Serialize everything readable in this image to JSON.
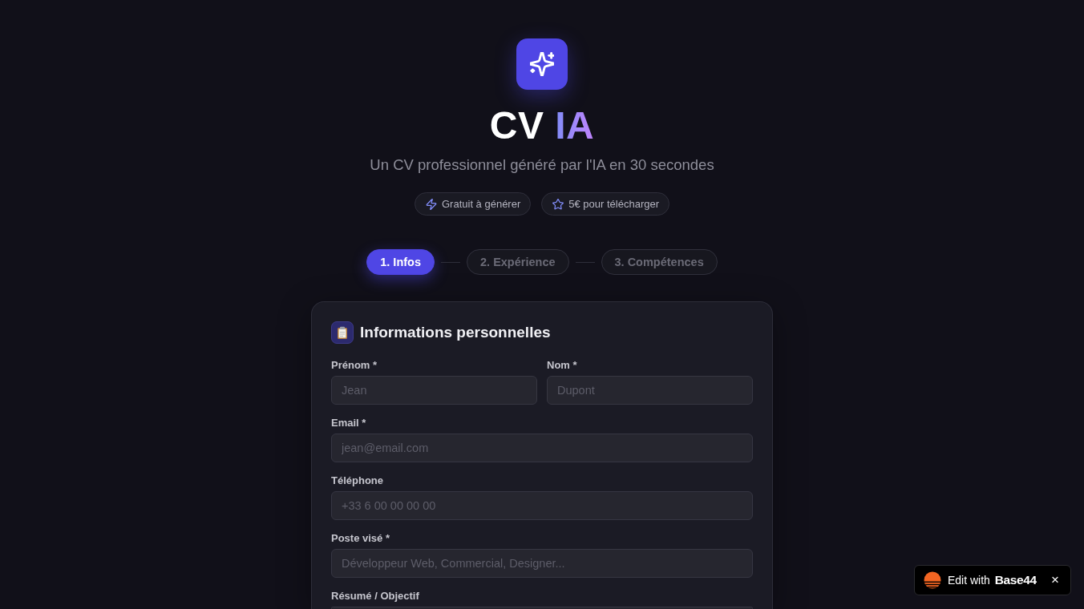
{
  "header": {
    "title": "CV",
    "title_accent": "IA",
    "subtitle": "Un CV professionnel généré par l'IA en 30 secondes",
    "badges": [
      {
        "kind": "bolt",
        "label": "Gratuit à générer"
      },
      {
        "kind": "star",
        "label": "5€ pour télécharger"
      }
    ]
  },
  "steps": [
    {
      "label": "1. Infos",
      "selected": true
    },
    {
      "label": "2. Expérience",
      "selected": false
    },
    {
      "label": "3. Compétences",
      "selected": false
    }
  ],
  "form": {
    "title": "Informations personnelles",
    "rows": [
      [
        {
          "kind": "text",
          "label": "Prénom *",
          "placeholder": "Jean"
        },
        {
          "kind": "text",
          "label": "Nom *",
          "placeholder": "Dupont"
        }
      ],
      [
        {
          "kind": "text",
          "label": "Email *",
          "placeholder": "jean@email.com"
        }
      ],
      [
        {
          "kind": "text",
          "label": "Téléphone",
          "placeholder": "+33 6 00 00 00 00"
        }
      ],
      [
        {
          "kind": "text",
          "label": "Poste visé *",
          "placeholder": "Développeur Web, Commercial, Designer..."
        }
      ],
      [
        {
          "kind": "textarea",
          "label": "Résumé / Objectif"
        }
      ]
    ]
  },
  "edit_banner": {
    "text": "Edit with **Base44**",
    "close": "×"
  }
}
